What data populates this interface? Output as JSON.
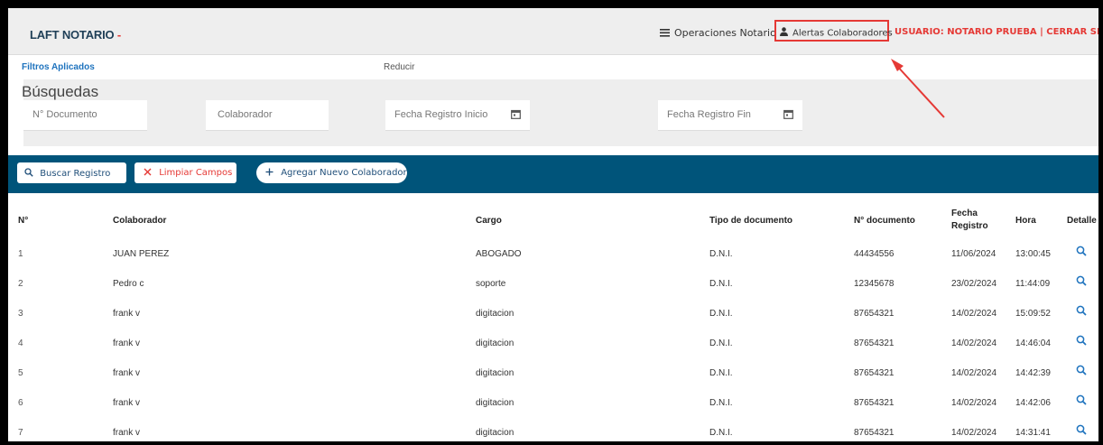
{
  "header": {
    "brand": "LAFT NOTARIO",
    "brand_suffix": "-",
    "nav_operations": "Operaciones Notario",
    "nav_alerts": "Alertas Colaboradores",
    "user_info": "USUARIO: NOTARIO PRUEBA | CERRAR SESIÓN"
  },
  "filters": {
    "applied_label": "Filtros Aplicados",
    "reduce_label": "Reducir",
    "search_title": "Búsquedas",
    "fields": {
      "doc_placeholder": "N° Documento",
      "colab_placeholder": "Colaborador",
      "start_date_placeholder": "Fecha Registro Inicio",
      "end_date_placeholder": "Fecha Registro Fin"
    }
  },
  "actions": {
    "search": "Buscar Registro",
    "clear": "Limpiar Campos",
    "add": "Agregar Nuevo Colaborador"
  },
  "table": {
    "headers": {
      "n": "N°",
      "colab": "Colaborador",
      "cargo": "Cargo",
      "tipo": "Tipo de documento",
      "doc": "N° documento",
      "fecha_1": "Fecha",
      "fecha_2": "Registro",
      "hora": "Hora",
      "detalle": "Detalle"
    },
    "rows": [
      {
        "n": "1",
        "colab": "JUAN PEREZ",
        "cargo": "ABOGADO",
        "tipo": "D.N.I.",
        "doc": "44434556",
        "fecha": "11/06/2024",
        "hora": "13:00:45"
      },
      {
        "n": "2",
        "colab": "Pedro c",
        "cargo": "soporte",
        "tipo": "D.N.I.",
        "doc": "12345678",
        "fecha": "23/02/2024",
        "hora": "11:44:09"
      },
      {
        "n": "3",
        "colab": "frank v",
        "cargo": "digitacion",
        "tipo": "D.N.I.",
        "doc": "87654321",
        "fecha": "14/02/2024",
        "hora": "15:09:52"
      },
      {
        "n": "4",
        "colab": "frank v",
        "cargo": "digitacion",
        "tipo": "D.N.I.",
        "doc": "87654321",
        "fecha": "14/02/2024",
        "hora": "14:46:04"
      },
      {
        "n": "5",
        "colab": "frank v",
        "cargo": "digitacion",
        "tipo": "D.N.I.",
        "doc": "87654321",
        "fecha": "14/02/2024",
        "hora": "14:42:39"
      },
      {
        "n": "6",
        "colab": "frank v",
        "cargo": "digitacion",
        "tipo": "D.N.I.",
        "doc": "87654321",
        "fecha": "14/02/2024",
        "hora": "14:42:06"
      },
      {
        "n": "7",
        "colab": "frank v",
        "cargo": "digitacion",
        "tipo": "D.N.I.",
        "doc": "87654321",
        "fecha": "14/02/2024",
        "hora": "14:31:41"
      }
    ]
  },
  "icons": {
    "menu": "list-icon",
    "user": "person-icon",
    "search": "search-icon",
    "clear": "close-icon",
    "add": "plus-icon",
    "calendar": "calendar-icon",
    "detail": "magnifier-icon"
  },
  "colors": {
    "brand": "#1f3f57",
    "accent_red": "#e53935",
    "action_bar": "#00547a",
    "link_blue": "#1e73be"
  }
}
